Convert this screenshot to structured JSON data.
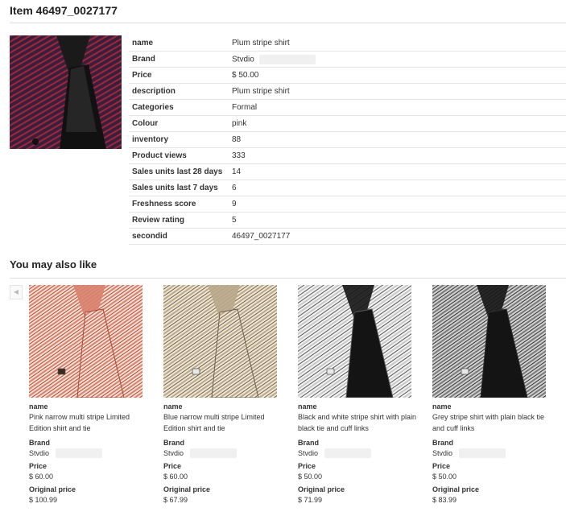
{
  "page": {
    "title": "Item 46497_0027177"
  },
  "item": {
    "image_icon": "plum-stripe-shirt-photo",
    "details": [
      {
        "key": "name",
        "value": "Plum stripe shirt"
      },
      {
        "key": "Brand",
        "value": "Stvdio"
      },
      {
        "key": "Price",
        "value": "$ 50.00"
      },
      {
        "key": "description",
        "value": "Plum stripe shirt"
      },
      {
        "key": "Categories",
        "value": "Formal"
      },
      {
        "key": "Colour",
        "value": "pink"
      },
      {
        "key": "inventory",
        "value": "88"
      },
      {
        "key": "Product views",
        "value": "333"
      },
      {
        "key": "Sales units last 28 days",
        "value": "14"
      },
      {
        "key": "Sales units last 7 days",
        "value": "6"
      },
      {
        "key": "Freshness score",
        "value": "9"
      },
      {
        "key": "Review rating",
        "value": "5"
      },
      {
        "key": "secondid",
        "value": "46497_0027177"
      }
    ]
  },
  "recommendations": {
    "title": "You may also like",
    "prev_icon": "chevron-left-icon",
    "labels": {
      "name": "name",
      "brand": "Brand",
      "price": "Price",
      "original_price": "Original price"
    },
    "items": [
      {
        "name": "Pink narrow multi stripe Limited Edition shirt and tie",
        "brand": "Stvdio",
        "price": "$ 60.00",
        "original_price": "$ 100.99",
        "colors": [
          "#d8826e",
          "#f4ddd2",
          "#a74a38"
        ]
      },
      {
        "name": "Blue narrow multi stripe Limited Edition shirt and tie",
        "brand": "Stvdio",
        "price": "$ 60.00",
        "original_price": "$ 67.99",
        "colors": [
          "#b9a88a",
          "#efe6d2",
          "#6d6050"
        ]
      },
      {
        "name": "Black and white stripe shirt with plain black tie and cuff links",
        "brand": "Stvdio",
        "price": "$ 50.00",
        "original_price": "$ 71.99",
        "colors": [
          "#c9c9c9",
          "#f2f2f2",
          "#555555"
        ]
      },
      {
        "name": "Grey stripe shirt with plain black tie and cuff links",
        "brand": "Stvdio",
        "price": "$ 50.00",
        "original_price": "$ 83.99",
        "colors": [
          "#7a7a7a",
          "#d0d0d0",
          "#2e2e2e"
        ]
      }
    ]
  }
}
